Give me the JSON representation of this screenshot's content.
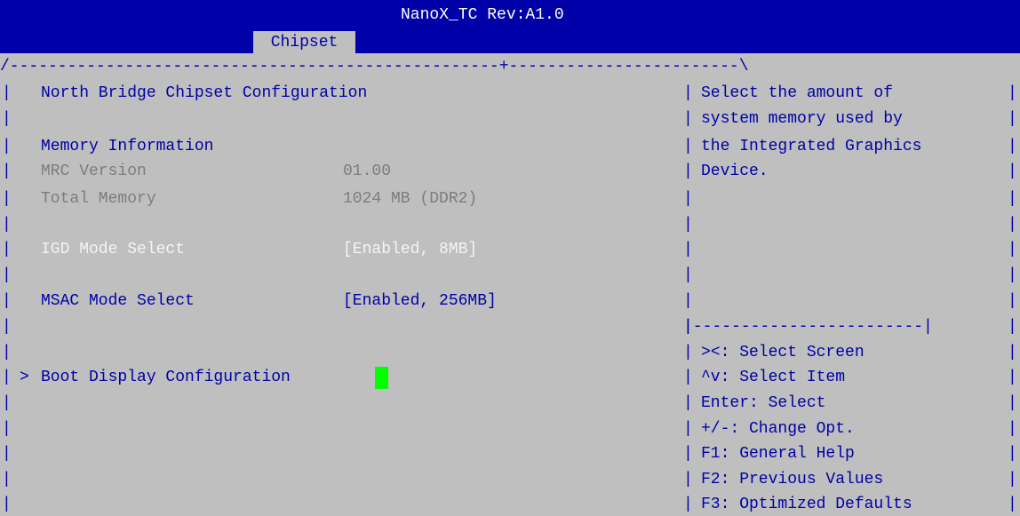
{
  "header": {
    "title": "NanoX_TC Rev:A1.0",
    "active_tab": "Chipset"
  },
  "frame": {
    "top_border": "/---------------------------------------------------+------------------------\\",
    "left_bar": "|",
    "right_bar": "|",
    "divider_bar": "|",
    "help_separator": "|------------------------|"
  },
  "main": {
    "section_title": "North Bridge Chipset Configuration",
    "memory_heading": "Memory Information",
    "mrc_label": "MRC Version",
    "mrc_value": "01.00",
    "total_mem_label": "Total Memory",
    "total_mem_value": "1024 MB (DDR2)",
    "igd_label": "IGD Mode Select",
    "igd_value": "[Enabled, 8MB]",
    "msac_label": "MSAC Mode Select",
    "msac_value": "[Enabled, 256MB]",
    "submenu_marker": ">",
    "submenu_label": "Boot Display Configuration"
  },
  "help": {
    "description": [
      "Select the amount of",
      "system memory used by",
      "the Integrated Graphics",
      "Device."
    ],
    "keys": [
      "><: Select Screen",
      "^v: Select Item",
      "Enter: Select",
      "+/-: Change Opt.",
      "F1: General Help",
      "F2: Previous Values",
      "F3: Optimized Defaults"
    ]
  },
  "colors": {
    "background": "#bfbfbf",
    "header": "#0000a8",
    "text_blue": "#0000a8",
    "text_disabled": "#7d7d7d",
    "text_highlight": "#f4f4f4",
    "cursor": "#00ff00"
  }
}
